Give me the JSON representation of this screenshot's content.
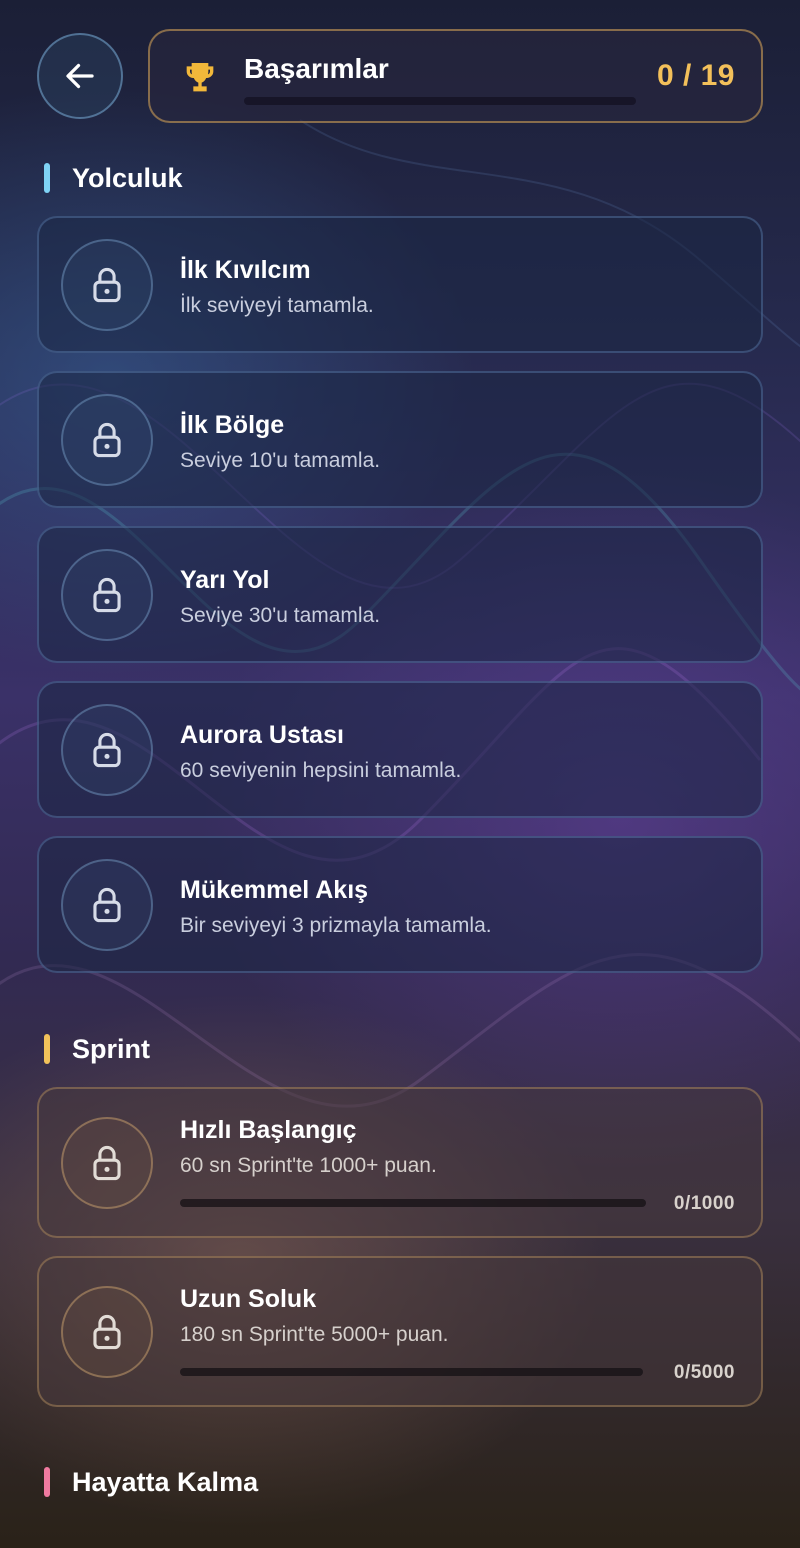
{
  "header": {
    "title": "Başarımlar",
    "count": "0 / 19",
    "progress": 0,
    "accent": "#f3c05a"
  },
  "icons": {
    "back": "arrow-left-icon",
    "trophy": "trophy-icon",
    "lock": "lock-icon"
  },
  "sections": [
    {
      "title": "Yolculuk",
      "color": "#7fd3f5",
      "items": [
        {
          "title": "İlk Kıvılcım",
          "desc": "İlk seviyeyi tamamla."
        },
        {
          "title": "İlk Bölge",
          "desc": "Seviye 10'u tamamla."
        },
        {
          "title": "Yarı Yol",
          "desc": "Seviye 30'u tamamla."
        },
        {
          "title": "Aurora Ustası",
          "desc": "60 seviyenin hepsini tamamla."
        },
        {
          "title": "Mükemmel Akış",
          "desc": "Bir seviyeyi 3 prizmayla tamamla."
        }
      ]
    },
    {
      "title": "Sprint",
      "color": "#f2c25a",
      "items": [
        {
          "title": "Hızlı Başlangıç",
          "desc": "60 sn Sprint'te 1000+ puan.",
          "progress_text": "0/1000",
          "progress": 0
        },
        {
          "title": "Uzun Soluk",
          "desc": "180 sn Sprint'te 5000+ puan.",
          "progress_text": "0/5000",
          "progress": 0
        }
      ]
    },
    {
      "title": "Hayatta Kalma",
      "color": "#f07aa0",
      "items": []
    }
  ]
}
